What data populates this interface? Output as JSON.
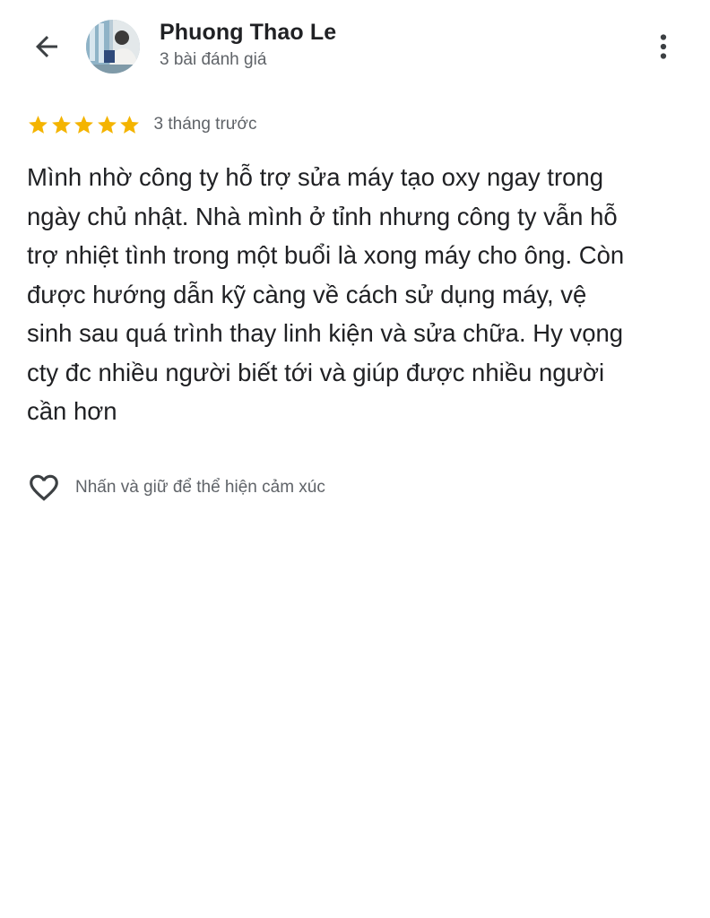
{
  "header": {
    "user_name": "Phuong Thao Le",
    "review_count": "3 bài đánh giá",
    "back_icon": "arrow-left-icon",
    "more_icon": "more-vert-icon"
  },
  "review": {
    "rating": 5,
    "max_rating": 5,
    "time_ago": "3 tháng trước",
    "text_lines": [
      "Mình nhờ công ty hỗ trợ sửa máy tạo oxy ngay trong",
      "ngày chủ nhật. Nhà mình ở tỉnh nhưng công ty vẫn hỗ",
      "trợ nhiệt tình trong một buổi là xong máy cho ông. Còn",
      "được hướng dẫn kỹ càng về cách sử dụng máy, vệ",
      "sinh sau quá trình thay linh kiện và sửa chữa. Hy vọng",
      "cty đc nhiều người biết tới và giúp được nhiều người",
      "cần hơn"
    ]
  },
  "reaction": {
    "hint": "Nhấn và giữ để thể hiện cảm xúc",
    "icon": "heart-outline-icon"
  },
  "colors": {
    "star": "#F4B400",
    "primary_text": "#202124",
    "secondary_text": "#5f6368",
    "icon": "#3c4043"
  }
}
